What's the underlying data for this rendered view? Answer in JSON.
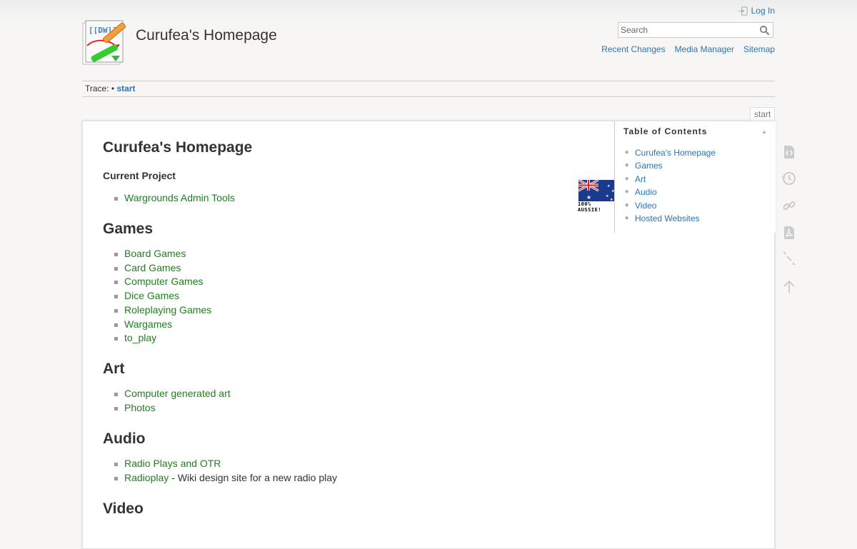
{
  "header": {
    "site_title": "Curufea's Homepage",
    "logo_text": "[[DW]]",
    "login_label": "Log In",
    "search_placeholder": "Search",
    "links": [
      "Recent Changes",
      "Media Manager",
      "Sitemap"
    ]
  },
  "trace": {
    "label": "Trace:",
    "bullet": "•",
    "crumb": "start"
  },
  "page_tab": "start",
  "content": {
    "title": "Curufea's Homepage",
    "current_project_heading": "Current Project",
    "current_project_items": [
      "Wargrounds Admin Tools"
    ],
    "flag_caption": "100% AUSSIE!",
    "sections": [
      {
        "heading": "Games",
        "items": [
          "Board Games",
          "Card Games",
          "Computer Games",
          "Dice Games",
          "Roleplaying Games",
          "Wargames",
          "to_play"
        ]
      },
      {
        "heading": "Art",
        "items": [
          "Computer generated art",
          "Photos"
        ]
      },
      {
        "heading": "Audio",
        "items": [
          "Radio Plays and OTR",
          "Radioplay"
        ],
        "radioplay_desc": " - Wiki design site for a new radio play"
      },
      {
        "heading": "Video",
        "items": []
      }
    ]
  },
  "toc": {
    "title": "Table of Contents",
    "items": [
      "Curufea's Homepage",
      "Games",
      "Art",
      "Audio",
      "Video",
      "Hosted Websites"
    ]
  },
  "tools": [
    "show-source-icon",
    "old-revisions-icon",
    "backlinks-icon",
    "export-pdf-icon",
    "collapse-icon",
    "back-to-top-icon"
  ]
}
